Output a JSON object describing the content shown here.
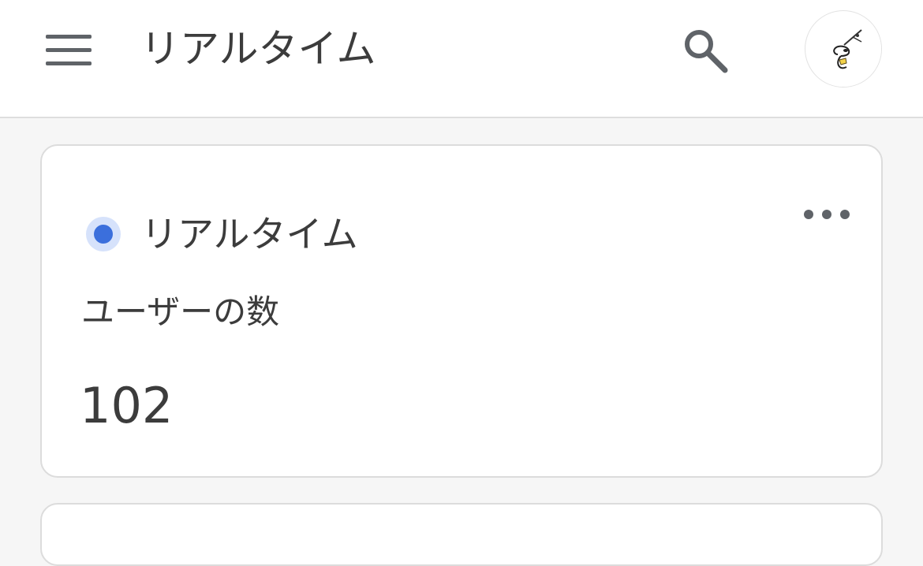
{
  "header": {
    "title": "リアルタイム",
    "menu_icon": "menu-icon",
    "search_icon": "search-icon",
    "avatar_icon": "avatar"
  },
  "card": {
    "title": "リアルタイム",
    "status_color": "#3b6fdc",
    "metric_label": "ユーザーの数",
    "metric_value": "102",
    "more_icon": "more-horizontal-icon"
  }
}
